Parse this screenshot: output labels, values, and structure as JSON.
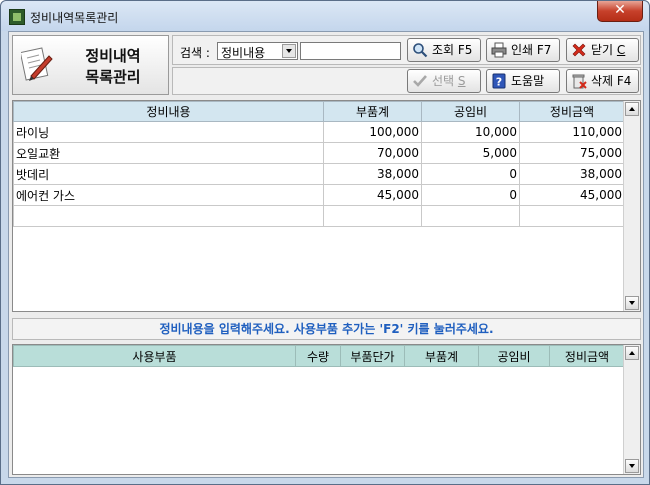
{
  "window": {
    "title": "정비내역목록관리",
    "close_glyph": "✕"
  },
  "header": {
    "title_line1": "정비내역",
    "title_line2": "목록관리"
  },
  "search": {
    "label": "검색 :",
    "selected_option": "정비내용",
    "input_value": ""
  },
  "buttons": {
    "query": {
      "label": "조회 F5",
      "icon": "magnifier-icon"
    },
    "print": {
      "label": "인쇄 F7",
      "icon": "printer-icon"
    },
    "close": {
      "label_prefix": "닫기 ",
      "shortcut": "C",
      "icon": "red-x-icon"
    },
    "select": {
      "label_prefix": "선택 ",
      "shortcut": "S",
      "icon": "check-icon"
    },
    "help": {
      "label": "도움말",
      "icon": "help-icon"
    },
    "delete": {
      "label": "삭제 F4",
      "icon": "trash-icon"
    }
  },
  "main_grid": {
    "columns": [
      "정비내용",
      "부품계",
      "공임비",
      "정비금액"
    ],
    "rows": [
      [
        "라이닝",
        "100,000",
        "10,000",
        "110,000"
      ],
      [
        "오일교환",
        "70,000",
        "5,000",
        "75,000"
      ],
      [
        "밧데리",
        "38,000",
        "0",
        "38,000"
      ],
      [
        "에어컨 가스",
        "45,000",
        "0",
        "45,000"
      ]
    ]
  },
  "hint": {
    "text": "정비내용을 입력해주세요. 사용부품 추가는 'F2' 키를 눌러주세요."
  },
  "parts_grid": {
    "columns": [
      "사용부품",
      "수량",
      "부품단가",
      "부품계",
      "공임비",
      "정비금액"
    ]
  },
  "colors": {
    "hint_text": "#1f5fbf",
    "main_header": "#d3e6f0",
    "parts_header": "#b9ded9",
    "close_button": "#c7412b"
  }
}
